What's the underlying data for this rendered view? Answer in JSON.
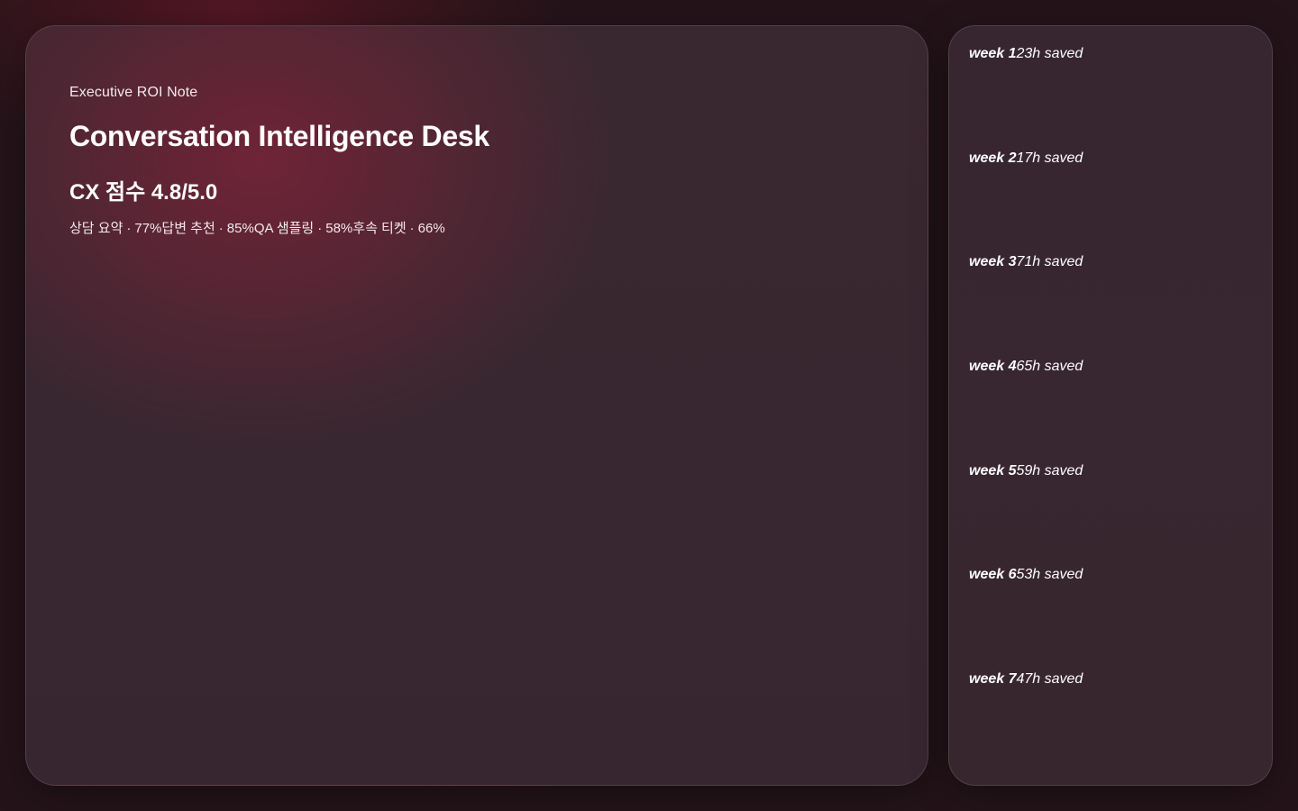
{
  "main": {
    "kicker": "Executive ROI Note",
    "title": "Conversation Intelligence Desk",
    "score": "CX 점수 4.8/5.0",
    "metrics": [
      {
        "label": "상담 요약",
        "value": "77%"
      },
      {
        "label": "답변 추천",
        "value": "85%"
      },
      {
        "label": "QA 샘플링",
        "value": "58%"
      },
      {
        "label": "후속 티켓",
        "value": "66%"
      }
    ],
    "separator": "·"
  },
  "weeks": [
    {
      "week": "week 1",
      "saved": "23h saved"
    },
    {
      "week": "week 2",
      "saved": "17h saved"
    },
    {
      "week": "week 3",
      "saved": "71h saved"
    },
    {
      "week": "week 4",
      "saved": "65h saved"
    },
    {
      "week": "week 5",
      "saved": "59h saved"
    },
    {
      "week": "week 6",
      "saved": "53h saved"
    },
    {
      "week": "week 7",
      "saved": "47h saved"
    }
  ]
}
